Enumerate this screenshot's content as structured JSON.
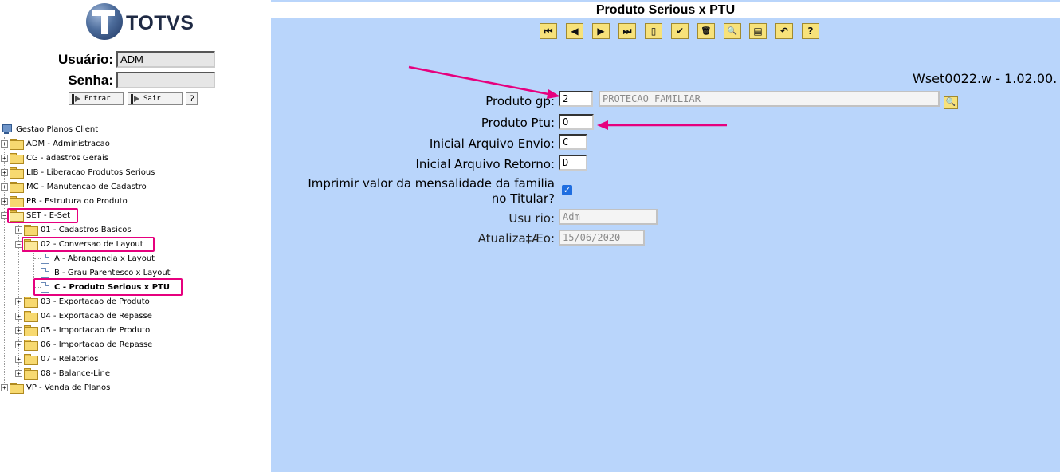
{
  "logo": {
    "brand": "TOTVS"
  },
  "login": {
    "user_label": "Usuário:",
    "user_value": "ADM",
    "password_label": "Senha:",
    "password_value": "",
    "enter_label": "Entrar",
    "exit_label": "Sair",
    "help_label": "?"
  },
  "tree": {
    "root": "Gestao Planos Client",
    "items": [
      {
        "label": "ADM - Administracao"
      },
      {
        "label": "CG - adastros Gerais"
      },
      {
        "label": "LIB - Liberacao Produtos Serious"
      },
      {
        "label": "MC - Manutencao de Cadastro"
      },
      {
        "label": "PR - Estrutura do Produto"
      },
      {
        "label": "SET - E-Set"
      },
      {
        "label": "01 - Cadastros Basicos"
      },
      {
        "label": "02 - Conversao de Layout"
      },
      {
        "label": "A - Abrangencia x Layout"
      },
      {
        "label": "B - Grau Parentesco x Layout"
      },
      {
        "label": "C - Produto Serious x PTU"
      },
      {
        "label": "03 - Exportacao de Produto"
      },
      {
        "label": "04 - Exportacao de Repasse"
      },
      {
        "label": "05 - Importacao de Produto"
      },
      {
        "label": "06 - Importacao de Repasse"
      },
      {
        "label": "07 - Relatorios"
      },
      {
        "label": "08 - Balance-Line"
      },
      {
        "label": "VP - Venda de Planos"
      }
    ]
  },
  "form": {
    "title": "Produto Serious x PTU",
    "version": "Wset0022.w - 1.02.00.",
    "toolbar_icons": [
      "first-icon",
      "prev-icon",
      "next-icon",
      "last-icon",
      "new-icon",
      "save-icon",
      "delete-icon",
      "search-icon",
      "notes-icon",
      "undo-icon",
      "help-icon"
    ],
    "toolbar_glyphs": [
      "⏮",
      "◀",
      "▶",
      "⏭",
      "▯",
      "✔",
      "🗑",
      "🔍",
      "▤",
      "↶",
      "?"
    ],
    "fields": {
      "produto_gp_label": "Produto gp:",
      "produto_gp_value": "2",
      "produto_gp_desc": "PROTECAO FAMILIAR",
      "produto_ptu_label": "Produto Ptu:",
      "produto_ptu_value": "O",
      "inicial_envio_label": "Inicial Arquivo Envio:",
      "inicial_envio_value": "C",
      "inicial_retorno_label": "Inicial Arquivo Retorno:",
      "inicial_retorno_value": "D",
      "imprimir_label_1": "Imprimir valor da mensalidade da familia",
      "imprimir_label_2": "no Titular?",
      "imprimir_checked": true,
      "usuario_label": "Usu rio:",
      "usuario_value": "Adm",
      "atualizacao_label": "Atualiza‡Æo:",
      "atualizacao_value": "15/06/2020"
    }
  },
  "colors": {
    "highlight": "#e6007e",
    "panel_bg": "#b9d5fb",
    "toolbar_btn": "#f7e27a"
  }
}
